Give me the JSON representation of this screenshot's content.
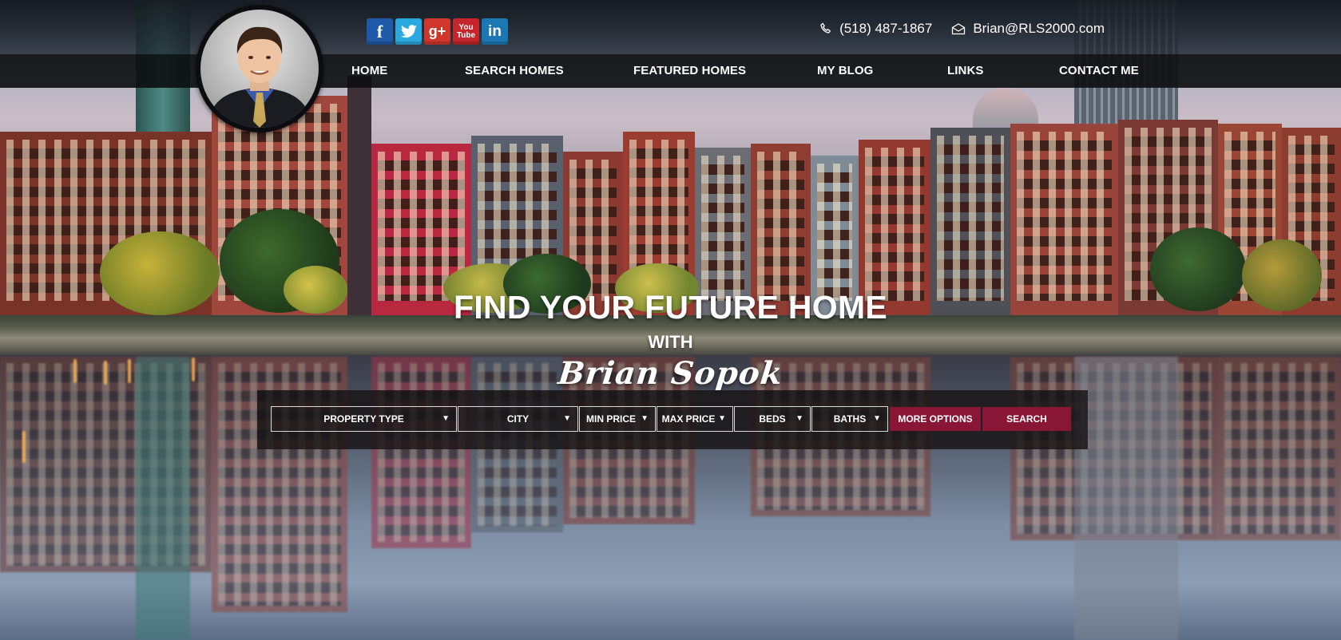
{
  "social": {
    "facebook_icon": "f",
    "twitter_icon": "t",
    "googleplus_icon": "g+",
    "youtube_icon": "You Tube",
    "linkedin_icon": "in",
    "colors": {
      "facebook": "#1f5aa8",
      "twitter": "#2aa9e0",
      "googleplus": "#d0372a",
      "youtube": "#c5252b",
      "linkedin": "#1c78b4"
    }
  },
  "contact": {
    "phone": "(518) 487-1867",
    "email": "Brian@RLS2000.com"
  },
  "nav": {
    "items": [
      "HOME",
      "SEARCH HOMES",
      "FEATURED HOMES",
      "MY BLOG",
      "LINKS",
      "CONTACT ME"
    ]
  },
  "hero": {
    "title": "FIND YOUR FUTURE HOME",
    "with": "WITH",
    "name": "Brian Sopok"
  },
  "search": {
    "property_type": "PROPERTY TYPE",
    "city": "CITY",
    "min_price": "MIN PRICE",
    "max_price": "MAX PRICE",
    "beds": "BEDS",
    "baths": "BATHS",
    "more_options": "MORE OPTIONS",
    "search": "SEARCH",
    "arrow": "▼",
    "accent_color": "#8a1635"
  }
}
